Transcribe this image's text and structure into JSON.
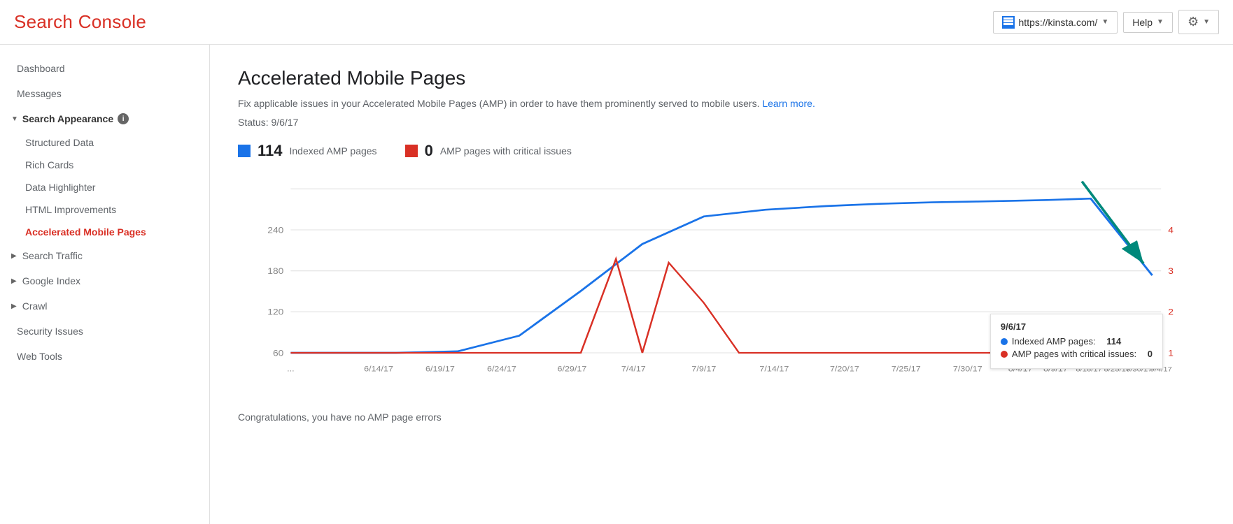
{
  "header": {
    "title": "Search Console",
    "site_url": "https://kinsta.com/",
    "help_label": "Help",
    "settings_label": "Settings"
  },
  "sidebar": {
    "dashboard_label": "Dashboard",
    "messages_label": "Messages",
    "search_appearance": {
      "label": "Search Appearance",
      "items": [
        {
          "label": "Structured Data",
          "active": false
        },
        {
          "label": "Rich Cards",
          "active": false
        },
        {
          "label": "Data Highlighter",
          "active": false
        },
        {
          "label": "HTML Improvements",
          "active": false
        },
        {
          "label": "Accelerated Mobile Pages",
          "active": true
        }
      ]
    },
    "search_traffic_label": "Search Traffic",
    "google_index_label": "Google Index",
    "crawl_label": "Crawl",
    "security_issues_label": "Security Issues",
    "web_tools_label": "Web Tools"
  },
  "main": {
    "heading": "Accelerated Mobile Pages",
    "description": "Fix applicable issues in your Accelerated Mobile Pages (AMP) in order to have them prominently served to mobile users.",
    "learn_more": "Learn more.",
    "status": "Status: 9/6/17",
    "indexed_count": "114",
    "indexed_label": "Indexed AMP pages",
    "critical_count": "0",
    "critical_label": "AMP pages with critical issues",
    "congratulations": "Congratulations, you have no AMP page errors"
  },
  "tooltip": {
    "date": "9/6/17",
    "blue_label": "Indexed AMP pages:",
    "blue_value": "114",
    "red_label": "AMP pages with critical issues:",
    "red_value": "0"
  },
  "chart": {
    "y_labels": [
      "60",
      "120",
      "180",
      "240"
    ],
    "y_right_labels": [
      "1",
      "2",
      "3",
      "4"
    ],
    "x_labels": [
      "...",
      "6/14/17",
      "6/19/17",
      "6/24/17",
      "6/29/17",
      "7/4/17",
      "7/9/17",
      "7/14/17",
      "7/20/17",
      "7/25/17",
      "7/30/17",
      "8/4/17",
      "8/9/17",
      "8/18/17",
      "8/25/17",
      "8/30/17",
      "9/4/17"
    ]
  }
}
